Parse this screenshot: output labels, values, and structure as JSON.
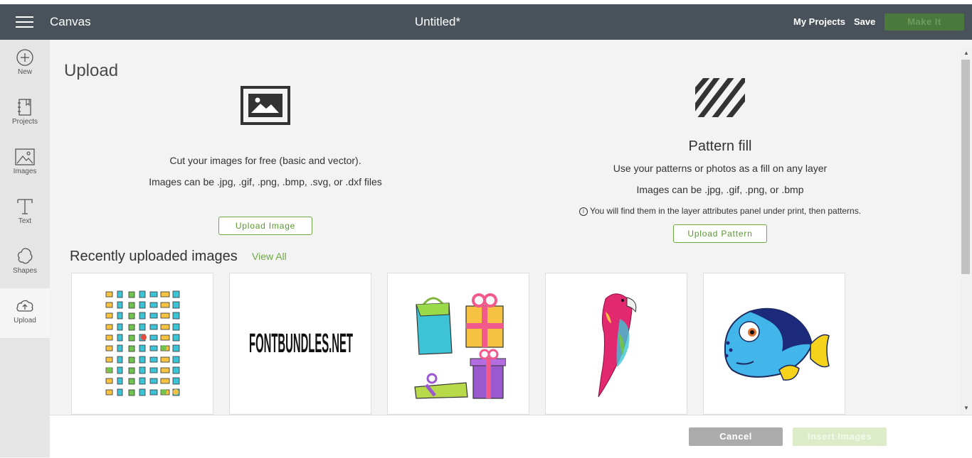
{
  "topbar": {
    "app_title": "Canvas",
    "doc_title": "Untitled*",
    "my_projects": "My Projects",
    "save": "Save",
    "make_it": "Make It"
  },
  "sidebar": {
    "items": [
      {
        "label": "New",
        "icon": "plus-circle-icon"
      },
      {
        "label": "Projects",
        "icon": "notebook-icon"
      },
      {
        "label": "Images",
        "icon": "image-icon"
      },
      {
        "label": "Text",
        "icon": "text-t-icon"
      },
      {
        "label": "Shapes",
        "icon": "shapes-icon"
      },
      {
        "label": "Upload",
        "icon": "cloud-upload-icon",
        "active": true
      }
    ]
  },
  "upload": {
    "title": "Upload",
    "image_section": {
      "line1": "Cut your images for free (basic and vector).",
      "line2": "Images can be .jpg, .gif, .png, .bmp, .svg, or .dxf files",
      "button": "Upload Image"
    },
    "pattern_section": {
      "title": "Pattern fill",
      "line1": "Use your patterns or photos as a fill on any layer",
      "line2": "Images can be .jpg, .gif, .png, or .bmp",
      "info": "You will find them in the layer attributes panel under print, then patterns.",
      "button": "Upload Pattern"
    }
  },
  "recent": {
    "title": "Recently uploaded images",
    "view_all": "View All",
    "cards": [
      {
        "name": "icon-set-thumbnail"
      },
      {
        "name": "fontbundles-logo-thumbnail",
        "text": "FONTBUNDLES.NET"
      },
      {
        "name": "gift-bags-thumbnail"
      },
      {
        "name": "parrot-thumbnail"
      },
      {
        "name": "fish-thumbnail"
      }
    ]
  },
  "footer": {
    "cancel": "Cancel",
    "insert": "Insert Images"
  },
  "colors": {
    "topbar": "#49525a",
    "accent_green": "#6ea843",
    "make_it_bg": "#4a7a3b"
  }
}
